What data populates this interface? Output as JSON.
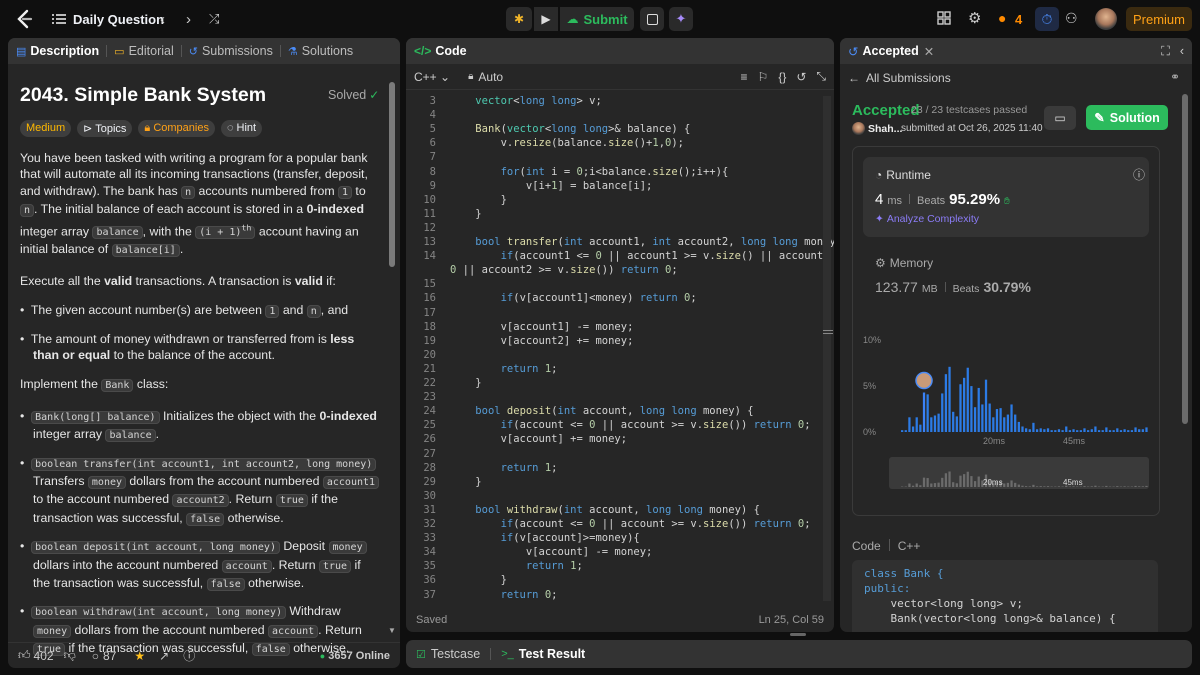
{
  "topbar": {
    "title": "Daily Question",
    "submit_label": "Submit",
    "streak": "4",
    "premium_label": "Premium"
  },
  "left": {
    "tabs": {
      "description": "Description",
      "editorial": "Editorial",
      "submissions": "Submissions",
      "solutions": "Solutions"
    },
    "title": "2043. Simple Bank System",
    "solved": "Solved",
    "difficulty": "Medium",
    "topics": "Topics",
    "companies": "Companies",
    "hint": "Hint",
    "likes": "402",
    "comments": "87",
    "online": "3657 Online"
  },
  "code": {
    "header": "Code",
    "language": "C++",
    "auto": "Auto",
    "status": "Saved",
    "position": "Ln 25, Col 59",
    "lines": [
      {
        "n": "3",
        "t": "    vector<long long> v;"
      },
      {
        "n": "4",
        "t": ""
      },
      {
        "n": "5",
        "t": "    Bank(vector<long long>& balance) {"
      },
      {
        "n": "6",
        "t": "        v.resize(balance.size()+1,0);"
      },
      {
        "n": "7",
        "t": ""
      },
      {
        "n": "8",
        "t": "        for(int i = 0;i<balance.size();i++){"
      },
      {
        "n": "9",
        "t": "            v[i+1] = balance[i];"
      },
      {
        "n": "10",
        "t": "        }"
      },
      {
        "n": "11",
        "t": "    }"
      },
      {
        "n": "12",
        "t": ""
      },
      {
        "n": "13",
        "t": "    bool transfer(int account1, int account2, long long money) {"
      },
      {
        "n": "14",
        "t": "        if(account1 <= 0 || account1 >= v.size() || account2 <="
      },
      {
        "n": "",
        "t": "0 || account2 >= v.size()) return 0;"
      },
      {
        "n": "15",
        "t": ""
      },
      {
        "n": "16",
        "t": "        if(v[account1]<money) return 0;"
      },
      {
        "n": "17",
        "t": ""
      },
      {
        "n": "18",
        "t": "        v[account1] -= money;"
      },
      {
        "n": "19",
        "t": "        v[account2] += money;"
      },
      {
        "n": "20",
        "t": ""
      },
      {
        "n": "21",
        "t": "        return 1;"
      },
      {
        "n": "22",
        "t": "    }"
      },
      {
        "n": "23",
        "t": ""
      },
      {
        "n": "24",
        "t": "    bool deposit(int account, long long money) {"
      },
      {
        "n": "25",
        "t": "        if(account <= 0 || account >= v.size()) return 0;"
      },
      {
        "n": "26",
        "t": "        v[account] += money;"
      },
      {
        "n": "27",
        "t": ""
      },
      {
        "n": "28",
        "t": "        return 1;"
      },
      {
        "n": "29",
        "t": "    }"
      },
      {
        "n": "30",
        "t": ""
      },
      {
        "n": "31",
        "t": "    bool withdraw(int account, long long money) {"
      },
      {
        "n": "32",
        "t": "        if(account <= 0 || account >= v.size()) return 0;"
      },
      {
        "n": "33",
        "t": "        if(v[account]>=money){"
      },
      {
        "n": "34",
        "t": "            v[account] -= money;"
      },
      {
        "n": "35",
        "t": "            return 1;"
      },
      {
        "n": "36",
        "t": "        }"
      },
      {
        "n": "37",
        "t": "        return 0;"
      }
    ]
  },
  "bottom": {
    "testcase": "Testcase",
    "test_result": "Test Result"
  },
  "right": {
    "tab": "Accepted",
    "all_submissions": "All Submissions",
    "accepted": "Accepted",
    "testcases": "23 / 23 testcases passed",
    "user": "Shah...",
    "submitted": "submitted at Oct 26, 2025 11:40",
    "solution_label": "Solution",
    "runtime_label": "Runtime",
    "runtime_value": "4",
    "runtime_unit": "ms",
    "beats_label": "Beats",
    "runtime_beats": "95.29%",
    "analyze": "Analyze Complexity",
    "memory_label": "Memory",
    "memory_value": "123.77",
    "memory_unit": "MB",
    "memory_beats": "30.79%",
    "code_label": "Code",
    "code_lang": "C++",
    "code_preview": [
      "class Bank {",
      "public:",
      "    vector<long long> v;",
      "    Bank(vector<long long>& balance) {"
    ]
  },
  "chart_data": {
    "type": "bar",
    "title": "",
    "ylabel": "",
    "y_ticks": [
      "10%",
      "5%",
      "0%"
    ],
    "x_ticks": [
      "20ms",
      "45ms"
    ],
    "ylim": [
      0,
      11
    ],
    "values": [
      0.2,
      0.2,
      1.6,
      0.6,
      1.6,
      0.8,
      4.3,
      4.1,
      1.6,
      1.8,
      2.0,
      4.2,
      6.3,
      7.1,
      2.2,
      1.7,
      5.2,
      5.9,
      7.0,
      5.0,
      2.7,
      4.8,
      3.0,
      5.7,
      3.1,
      1.6,
      2.5,
      2.6,
      1.6,
      1.9,
      3.0,
      1.9,
      1.1,
      0.6,
      0.4,
      0.3,
      1.0,
      0.3,
      0.4,
      0.3,
      0.4,
      0.2,
      0.2,
      0.3,
      0.2,
      0.6,
      0.2,
      0.3,
      0.2,
      0.2,
      0.4,
      0.2,
      0.3,
      0.6,
      0.2,
      0.2,
      0.5,
      0.2,
      0.2,
      0.4,
      0.2,
      0.3,
      0.2,
      0.2,
      0.5,
      0.3,
      0.3,
      0.5
    ],
    "highlight_index": 6,
    "bar_color": "#2c7be5",
    "highlight_color": "#3b82f6"
  }
}
